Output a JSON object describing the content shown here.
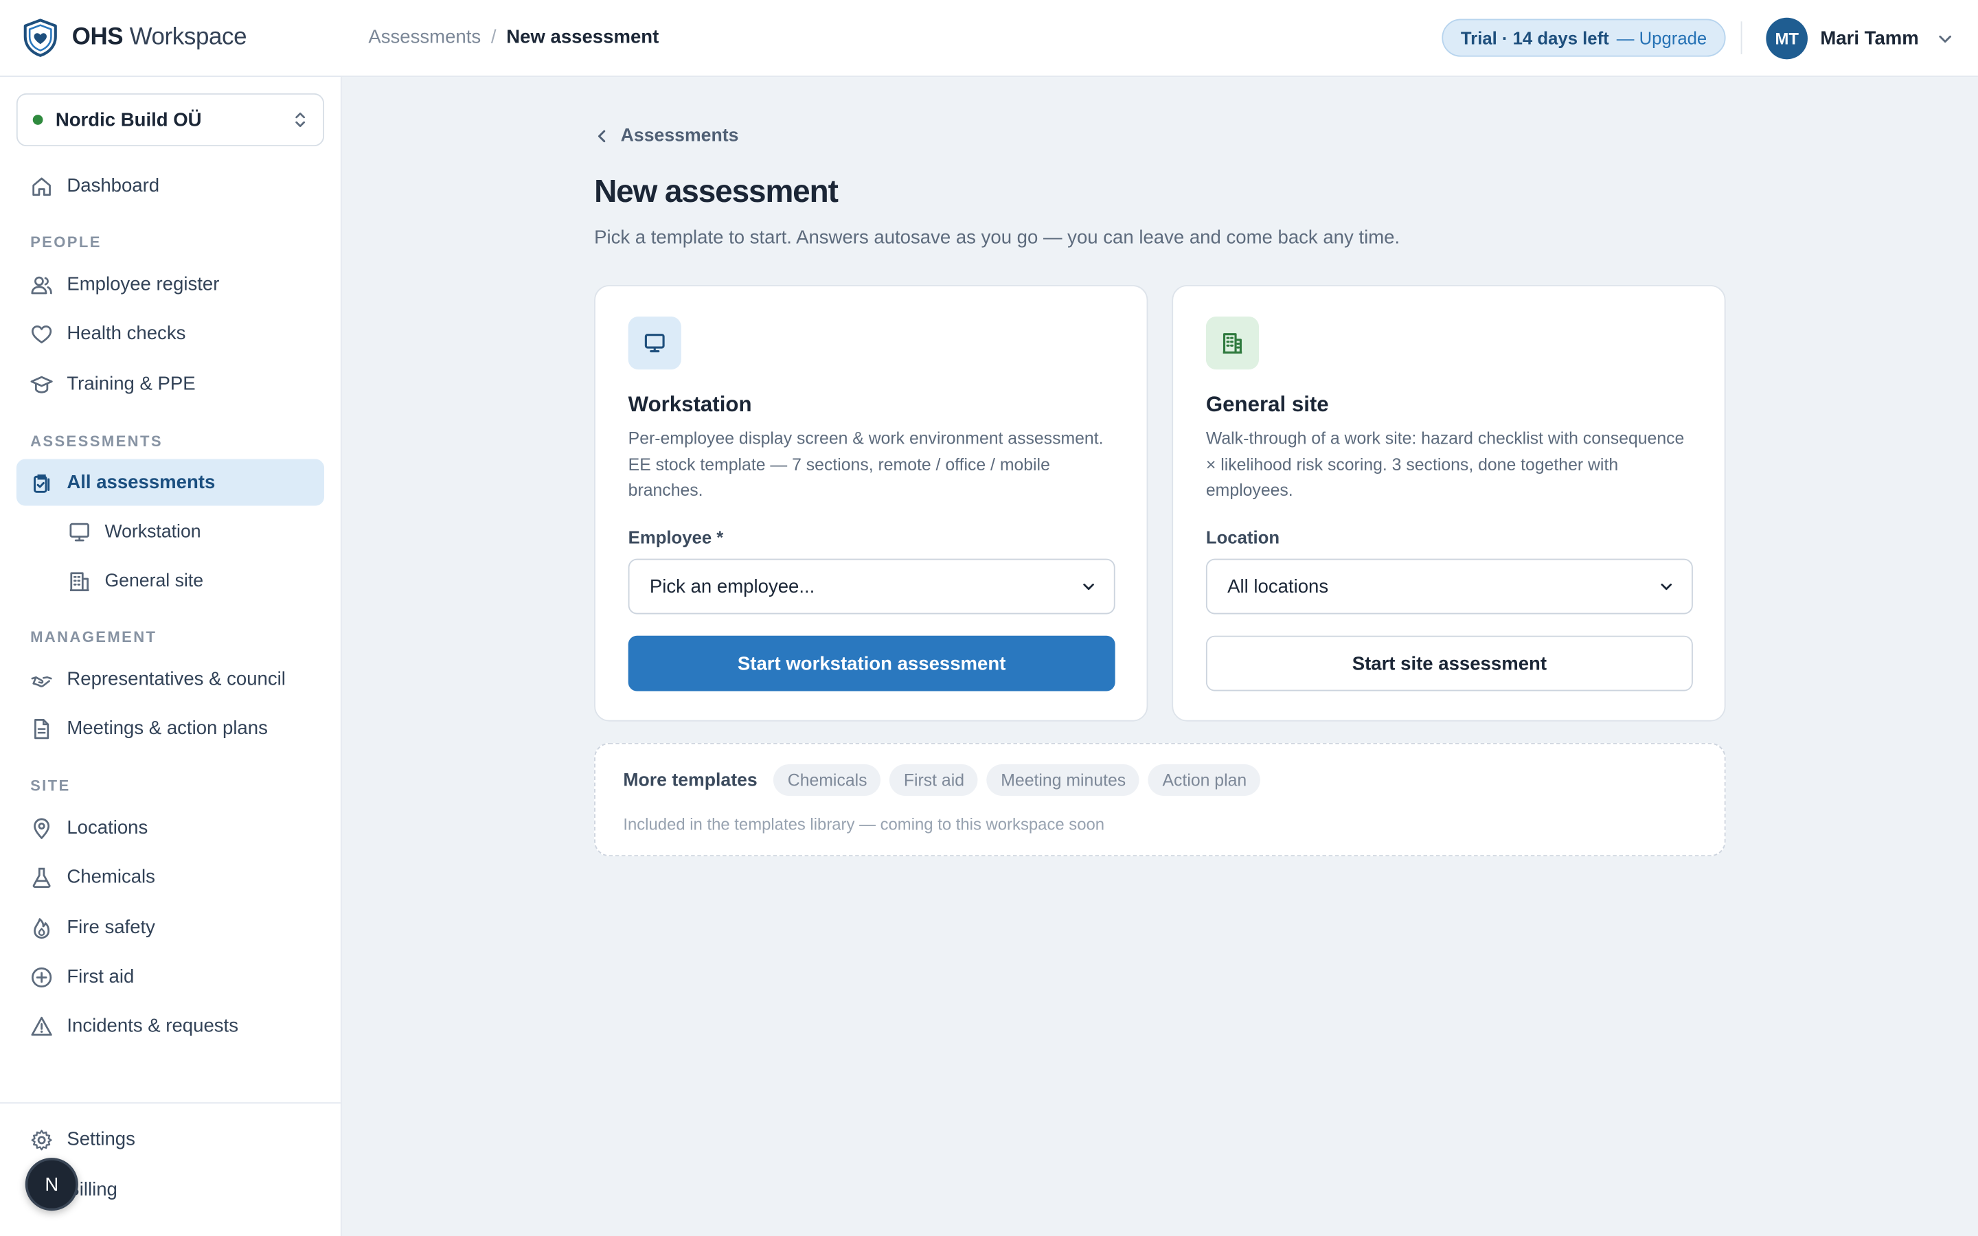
{
  "brand": {
    "bold": "OHS",
    "light": "Workspace"
  },
  "breadcrumb": {
    "parent": "Assessments",
    "separator": "/",
    "current": "New assessment"
  },
  "trial": {
    "label": "Trial · 14 days left",
    "upgrade": "— Upgrade"
  },
  "user": {
    "initials": "MT",
    "name": "Mari Tamm"
  },
  "org": {
    "name": "Nordic Build OÜ",
    "status_color": "#2f8a3e"
  },
  "sidebar": {
    "dashboard": "Dashboard",
    "sections": {
      "people": "PEOPLE",
      "assessments": "ASSESSMENTS",
      "management": "MANAGEMENT",
      "site": "SITE"
    },
    "people": [
      "Employee register",
      "Health checks",
      "Training & PPE"
    ],
    "assessments": {
      "all": "All assessments",
      "workstation": "Workstation",
      "general_site": "General site"
    },
    "management": [
      "Representatives & council",
      "Meetings & action plans"
    ],
    "site": [
      "Locations",
      "Chemicals",
      "Fire safety",
      "First aid",
      "Incidents & requests"
    ],
    "settings": "Settings",
    "billing": "Billing"
  },
  "fab": {
    "label": "N"
  },
  "main": {
    "back": "Assessments",
    "title": "New assessment",
    "subtitle": "Pick a template to start. Answers autosave as you go — you can leave and come back any time.",
    "workstation": {
      "title": "Workstation",
      "description": "Per-employee display screen & work environment assessment. EE stock template — 7 sections, remote / office / mobile branches.",
      "field_label": "Employee *",
      "select_value": "Pick an employee...",
      "button": "Start workstation assessment"
    },
    "general_site": {
      "title": "General site",
      "description": "Walk-through of a work site: hazard checklist with consequence × likelihood risk scoring. 3 sections, done together with employees.",
      "field_label": "Location",
      "select_value": "All locations",
      "button": "Start site assessment"
    },
    "more": {
      "title": "More templates",
      "chips": [
        "Chemicals",
        "First aid",
        "Meeting minutes",
        "Action plan"
      ],
      "note": "Included in the templates library — coming to this workspace soon"
    }
  },
  "colors": {
    "accent": "#2a78bf",
    "active_bg": "#dcebf8",
    "avatar": "#1f5d91"
  }
}
